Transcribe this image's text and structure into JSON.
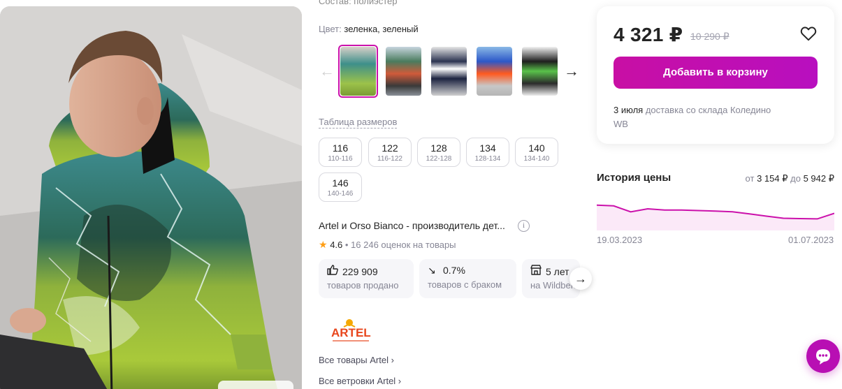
{
  "product": {
    "composition_text": "Состав: полиэстер",
    "color_label": "Цвет:",
    "color_value": "зеленка, зеленый",
    "size_table_link": "Таблица размеров",
    "sizes": [
      {
        "size": "116",
        "range": "110-116"
      },
      {
        "size": "122",
        "range": "116-122"
      },
      {
        "size": "128",
        "range": "122-128"
      },
      {
        "size": "134",
        "range": "128-134"
      },
      {
        "size": "140",
        "range": "134-140"
      },
      {
        "size": "146",
        "range": "140-146"
      }
    ],
    "thumbnails": [
      {
        "icon": "photo-thumbnail",
        "selected": true
      },
      {
        "icon": "photo-thumbnail",
        "selected": false
      },
      {
        "icon": "photo-thumbnail",
        "selected": false
      },
      {
        "icon": "photo-thumbnail",
        "selected": false
      },
      {
        "icon": "photo-thumbnail",
        "selected": false
      }
    ]
  },
  "seller": {
    "maker_text": "Artel и Orso Bianco - производитель дет...",
    "info_glyph": "i",
    "rating": "4.6",
    "reviews": "• 16 246 оценок на товары",
    "stats": [
      {
        "icon": "thumbs-up-icon",
        "glyph": "👍",
        "value": "229 909",
        "caption": "товаров продано"
      },
      {
        "icon": "trend-down-icon",
        "glyph": "↘",
        "value": "0.7%",
        "caption": "товаров с браком"
      },
      {
        "icon": "store-icon",
        "glyph": "▣",
        "value": "5 лет",
        "caption": "на Wildberries"
      }
    ],
    "brand_logo_text": "ARTEL",
    "all_items_link": "Все товары Artel ›",
    "all_jackets_link": "Все ветровки Artel ›"
  },
  "buy": {
    "price": "4 321 ₽",
    "old_price": "10 290 ₽",
    "add_to_cart": "Добавить в корзину",
    "delivery_date": "3 июля",
    "delivery_text": " доставка со склада Коледино WB"
  },
  "price_history": {
    "title": "История цены",
    "range_from_label": "от",
    "range_from": "3 154 ₽",
    "range_to_label": "до",
    "range_to": "5 942 ₽",
    "start_date": "19.03.2023",
    "end_date": "01.07.2023",
    "points": [
      5520,
      5470,
      5100,
      5290,
      5210,
      5210,
      5180,
      5150,
      5100,
      4970,
      4830,
      4700,
      4680,
      4660,
      5010
    ]
  },
  "colors": {
    "accent": "#cb11ab",
    "text": "#242424",
    "muted": "#868695"
  }
}
